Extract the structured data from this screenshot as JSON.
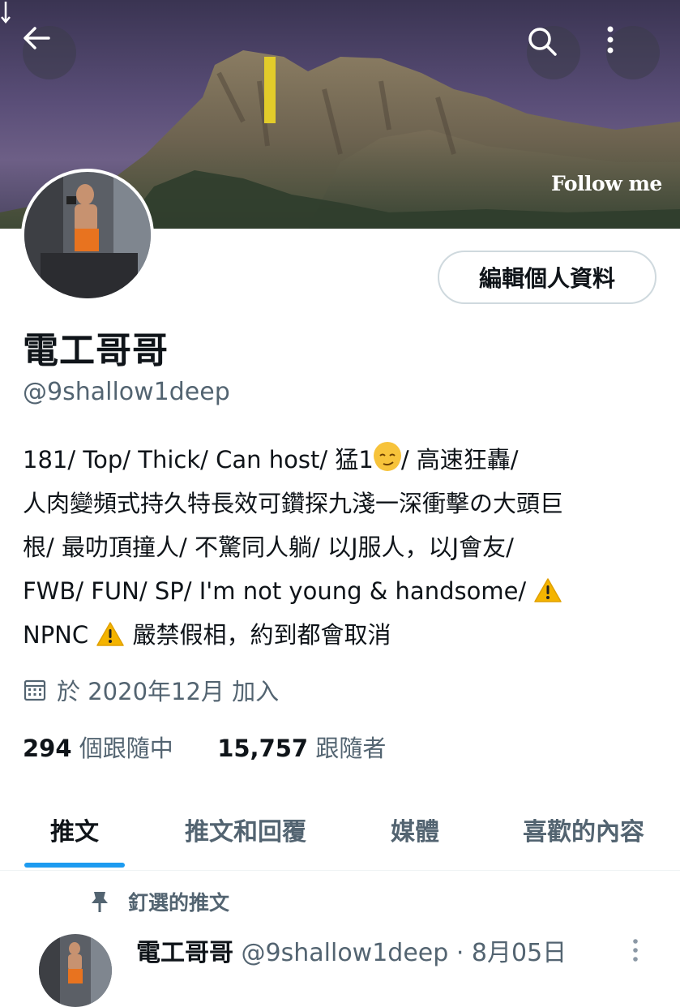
{
  "banner": {
    "follow_text": "Follow me"
  },
  "header_icons": {
    "back": "arrow-left-icon",
    "search": "search-icon",
    "more": "more-vertical-icon"
  },
  "profile": {
    "edit_button_label": "編輯個人資料",
    "display_name": "電工哥哥",
    "handle": "@9shallow1deep",
    "bio": {
      "line1_a": "181/ Top/ Thick/ Can host/  猛1",
      "line1_b": "/  高速狂轟/",
      "line2": "人肉變頻式持久特長效可鑽探九淺一深衝擊の大頭巨",
      "line3": "根/  最叻頂撞人/  不驚同人躺/  以J服人，以J會友/",
      "line4": "FWB/ FUN/ SP/  I'm not young & handsome/ ",
      "line5_a": "NPNC ",
      "line5_b": " 嚴禁假相，約到都會取消"
    },
    "joined": "於 2020年12月 加入",
    "following_count": "294",
    "following_label": " 個跟隨中",
    "followers_count": "15,757",
    "followers_label": " 跟隨者"
  },
  "tabs": [
    "推文",
    "推文和回覆",
    "媒體",
    "喜歡的內容"
  ],
  "active_tab": 0,
  "pinned": {
    "label": "釘選的推文",
    "tweet_name": "電工哥哥",
    "tweet_meta": " @9shallow1deep · 8月05日"
  },
  "colors": {
    "accent": "#1d9bf0",
    "text_primary": "#0f1419",
    "text_secondary": "#536471",
    "warning": "#f4b400"
  }
}
